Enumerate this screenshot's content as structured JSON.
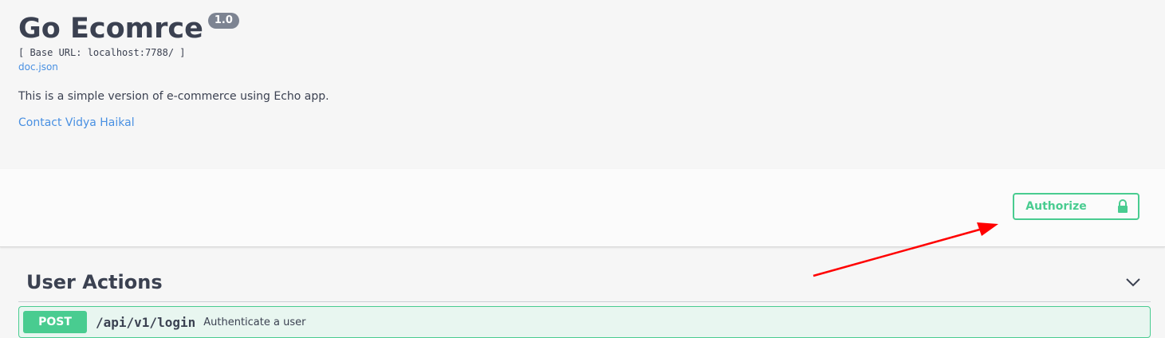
{
  "info": {
    "title": "Go Ecomrce",
    "version": "1.0",
    "base_url": "[ Base URL: localhost:7788/ ]",
    "doc_link": "doc.json",
    "description": "This is a simple version of e-commerce using Echo app.",
    "contact": "Contact Vidya Haikal"
  },
  "auth": {
    "authorize_label": "Authorize",
    "icon": "lock-icon"
  },
  "tags": [
    {
      "name": "User Actions",
      "operations": [
        {
          "method": "POST",
          "path": "/api/v1/login",
          "summary": "Authenticate a user"
        }
      ]
    }
  ],
  "colors": {
    "post": "#49cc90",
    "link": "#4990e2",
    "arrow": "#ff0000",
    "text": "#3b4151"
  }
}
